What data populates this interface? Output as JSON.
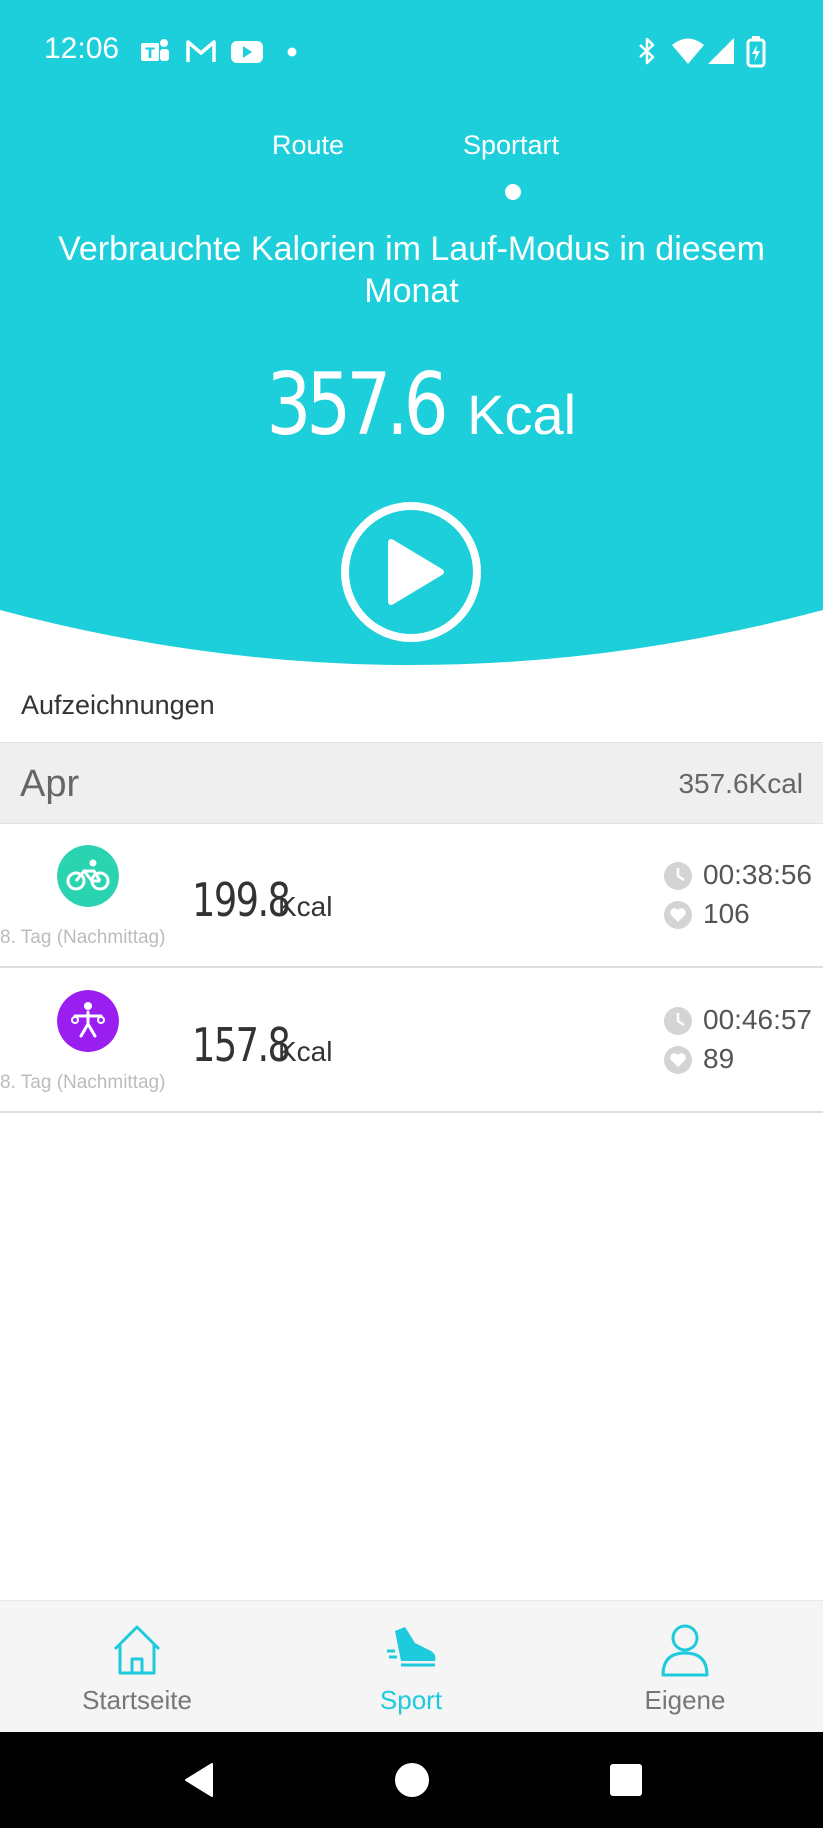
{
  "status_bar": {
    "time": "12:06",
    "icons": [
      "teams-icon",
      "gmail-icon",
      "youtube-icon",
      "dot-icon",
      "bluetooth-icon",
      "wifi-icon",
      "signal-icon",
      "battery-icon"
    ]
  },
  "tabs": [
    {
      "label": "Route",
      "active": false
    },
    {
      "label": "Sportart",
      "active": true
    }
  ],
  "summary": {
    "subtitle": "Verbrauchte Kalorien im Lauf-Modus in diesem Monat",
    "value": "357.6",
    "unit": "Kcal"
  },
  "records_label": "Aufzeichnungen",
  "month": {
    "name": "Apr",
    "total": "357.6Kcal"
  },
  "records": [
    {
      "icon": "bicycle-icon",
      "date": "8. Tag (Nachmittag)",
      "value": "199.8",
      "unit": "Kcal",
      "duration": "00:38:56",
      "heart_rate": "106"
    },
    {
      "icon": "workout-icon",
      "date": "8. Tag (Nachmittag)",
      "value": "157.8",
      "unit": "Kcal",
      "duration": "00:46:57",
      "heart_rate": "89"
    }
  ],
  "bottom_nav": [
    {
      "label": "Startseite",
      "icon": "home-icon",
      "active": false
    },
    {
      "label": "Sport",
      "icon": "shoe-icon",
      "active": true
    },
    {
      "label": "Eigene",
      "icon": "person-icon",
      "active": false
    }
  ],
  "colors": {
    "accent": "#1ecbdc",
    "bicycle": "#2bd4b0",
    "workout": "#9a1ef0"
  }
}
